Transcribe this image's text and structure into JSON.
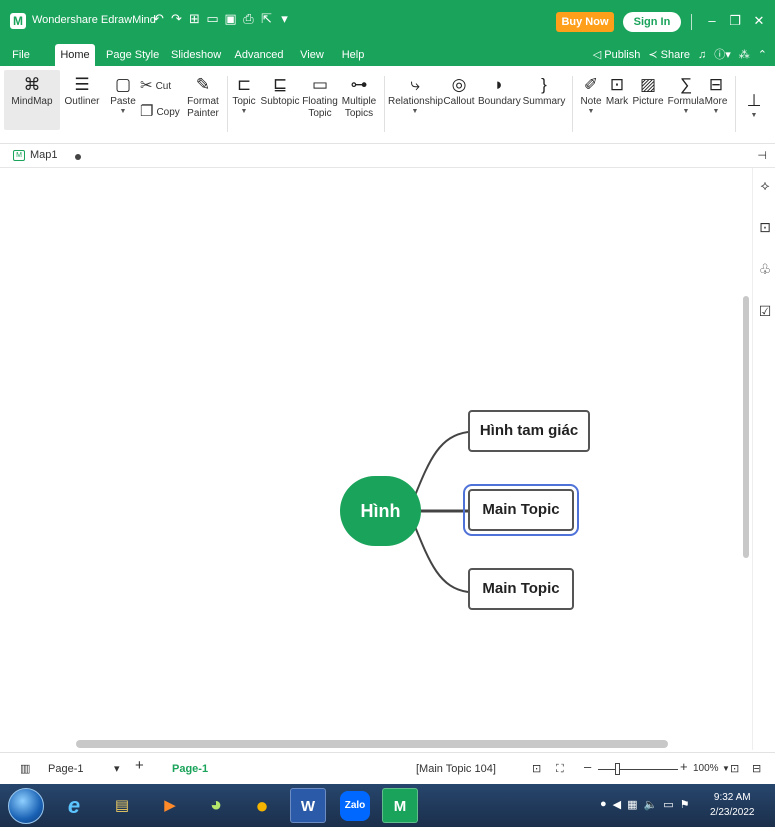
{
  "app": {
    "title": "Wondershare EdrawMind",
    "logo_glyph": "M",
    "buy_now": "Buy Now",
    "sign_in": "Sign In",
    "accent": "#1aa35a"
  },
  "menu": {
    "tabs": [
      "File",
      "Home",
      "Page Style",
      "Slideshow",
      "Advanced",
      "View",
      "Help"
    ],
    "active": "Home",
    "publish": "Publish",
    "share": "Share"
  },
  "ribbon": {
    "mindmap": "MindMap",
    "outliner": "Outliner",
    "paste": "Paste",
    "cut": "Cut",
    "copy": "Copy",
    "format_painter_1": "Format",
    "format_painter_2": "Painter",
    "topic": "Topic",
    "subtopic": "Subtopic",
    "floating_1": "Floating",
    "floating_2": "Topic",
    "multiple_1": "Multiple",
    "multiple_2": "Topics",
    "relationship": "Relationship",
    "callout": "Callout",
    "boundary": "Boundary",
    "summary": "Summary",
    "note": "Note",
    "mark": "Mark",
    "picture": "Picture",
    "formula": "Formula",
    "more": "More"
  },
  "document": {
    "tab": "Map1"
  },
  "map": {
    "central": "Hình",
    "topics": [
      "Hình tam giác",
      "Main Topic",
      "Main Topic"
    ],
    "selected_index": 1
  },
  "status": {
    "page_select": "Page-1",
    "page_tab": "Page-1",
    "selection": "[Main Topic 104]",
    "zoom": "100%"
  },
  "taskbar": {
    "zalo": "Zalo",
    "word": "W",
    "time": "9:32 AM",
    "date": "2/23/2022"
  }
}
